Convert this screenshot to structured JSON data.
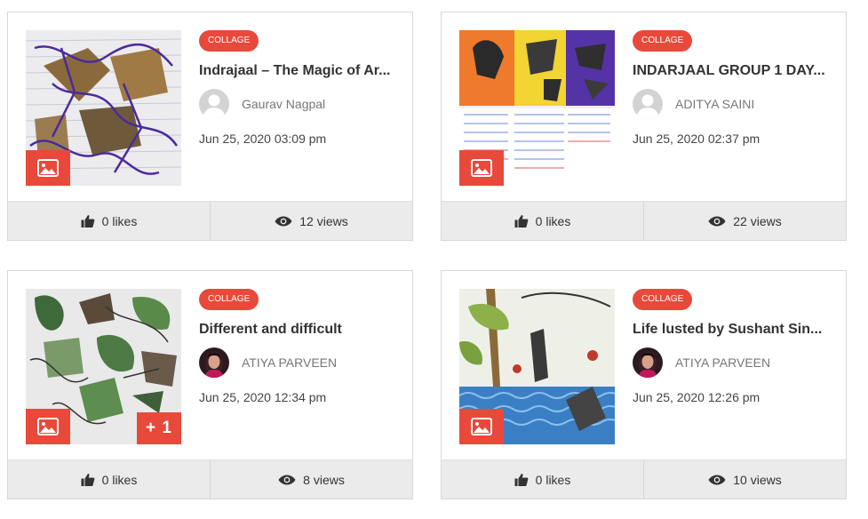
{
  "colors": {
    "accent": "#e8493a",
    "stats_bg": "#ebebeb"
  },
  "cards": [
    {
      "tag": "COLLAGE",
      "title": "Indrajaal – The Magic of Ar...",
      "author": "Gaurav Nagpal",
      "avatar": "default-avatar-icon",
      "date": "Jun 25, 2020 03:09 pm",
      "likes": "0 likes",
      "views": "12 views",
      "extra_images": ""
    },
    {
      "tag": "COLLAGE",
      "title": "INDARJAAL GROUP 1 DAY...",
      "author": "ADITYA SAINI",
      "avatar": "default-avatar-icon",
      "date": "Jun 25, 2020 02:37 pm",
      "likes": "0 likes",
      "views": "22 views",
      "extra_images": ""
    },
    {
      "tag": "COLLAGE",
      "title": "Different and difficult",
      "author": "ATIYA PARVEEN",
      "avatar": "profile-photo",
      "date": "Jun 25, 2020 12:34 pm",
      "likes": "0 likes",
      "views": "8 views",
      "extra_images": "+ 1"
    },
    {
      "tag": "COLLAGE",
      "title": "Life lusted by Sushant Sin...",
      "author": "ATIYA PARVEEN",
      "avatar": "profile-photo",
      "date": "Jun 25, 2020 12:26 pm",
      "likes": "0 likes",
      "views": "10 views",
      "extra_images": ""
    }
  ]
}
